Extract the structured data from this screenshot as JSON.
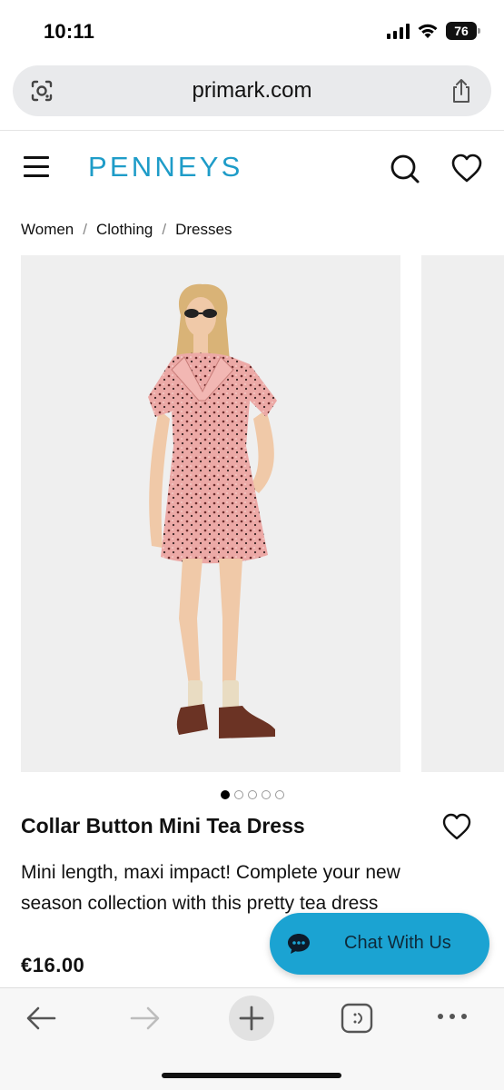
{
  "status_bar": {
    "time": "10:11",
    "battery": "76"
  },
  "browser": {
    "url": "primark.com"
  },
  "site": {
    "logo": "PENNEYS",
    "breadcrumb": [
      "Women",
      "Clothing",
      "Dresses"
    ],
    "breadcrumb_separator": "/"
  },
  "gallery": {
    "image_count": 5,
    "active_index": 0
  },
  "product": {
    "title": "Collar Button Mini Tea Dress",
    "description": "Mini length, maxi impact! Complete your new season collection with this pretty tea dress",
    "price": "€16.00"
  },
  "chat": {
    "label": "Chat With Us"
  },
  "colors": {
    "brand": "#1e9cc8",
    "chat_button": "#1ba3d2",
    "dress": "#e8a7a4"
  },
  "icons": {
    "status": [
      "signal-icon",
      "wifi-icon",
      "battery-icon"
    ],
    "url_bar": [
      "google-lens-icon",
      "share-icon"
    ],
    "header": [
      "menu-icon",
      "search-icon",
      "heart-icon"
    ],
    "toolbar": [
      "back-arrow-icon",
      "forward-arrow-icon",
      "plus-icon",
      "tabs-icon",
      "more-icon"
    ]
  }
}
